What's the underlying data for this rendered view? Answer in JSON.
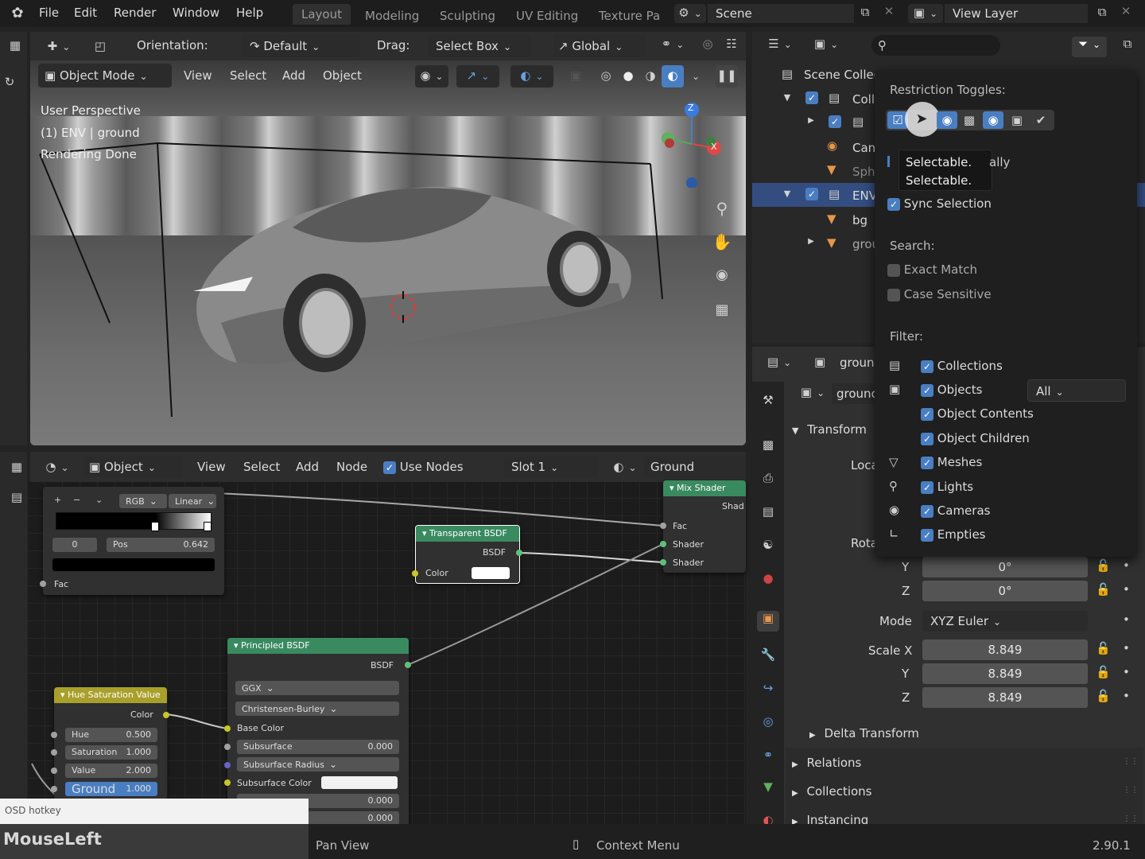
{
  "topbar": {
    "menus": [
      "File",
      "Edit",
      "Render",
      "Window",
      "Help"
    ],
    "workspaces": [
      "Layout",
      "Modeling",
      "Sculpting",
      "UV Editing",
      "Texture Pa"
    ],
    "scene": "Scene",
    "view_layer": "View Layer"
  },
  "viewport_header": {
    "orientation_label": "Orientation:",
    "orientation_value": "Default",
    "drag_label": "Drag:",
    "drag_value": "Select Box",
    "transform_space": "Global"
  },
  "viewport_toolbar": {
    "mode": "Object Mode",
    "menus": [
      "View",
      "Select",
      "Add",
      "Object"
    ]
  },
  "viewport_overlay": {
    "line1": "User Perspective",
    "line2": "(1) ENV | ground",
    "line3": "Rendering Done"
  },
  "gizmo": {
    "z": "Z",
    "x": "X"
  },
  "node_header": {
    "type": "Object",
    "menus": [
      "View",
      "Select",
      "Add",
      "Node"
    ],
    "use_nodes": "Use Nodes",
    "slot": "Slot 1",
    "material": "Ground"
  },
  "nodes": {
    "color_ramp": {
      "mode": "RGB",
      "interp": "Linear",
      "index": "0",
      "pos_label": "Pos",
      "pos_value": "0.642",
      "fac": "Fac",
      "stop_position": 0.642
    },
    "mix_shader": {
      "title": "Mix Shader",
      "out": "Shad",
      "in1": "Fac",
      "in2": "Shader",
      "in3": "Shader"
    },
    "transparent": {
      "title": "Transparent BSDF",
      "out": "BSDF",
      "color": "Color"
    },
    "principled": {
      "title": "Principled BSDF",
      "out": "BSDF",
      "distribution": "GGX",
      "sss": "Christensen-Burley",
      "base_color": "Base Color",
      "subsurface": "Subsurface",
      "subsurface_value": "0.000",
      "subsurface_radius": "Subsurface Radius",
      "subsurface_color": "Subsurface Color",
      "v1": "0.000",
      "v2": "0.000"
    },
    "hsv": {
      "title": "Hue Saturation Value",
      "out": "Color",
      "hue": "Hue",
      "hue_value": "0.500",
      "sat": "Saturation",
      "sat_value": "1.000",
      "val": "Value",
      "val_value": "2.000",
      "fac": "Ground",
      "fac_value": "1.000"
    }
  },
  "outliner": {
    "root": "Scene Collec",
    "rows": [
      "Coll",
      "",
      "Can",
      "Sph",
      "ENV",
      "bg",
      "grou"
    ]
  },
  "filter_popup": {
    "restriction_title": "Restriction Toggles:",
    "tooltip_line1": "Selectable.",
    "tooltip_line2": "Selectable.",
    "tooltip_tail": "ally",
    "sync_selection": "Sync Selection",
    "search_title": "Search:",
    "exact_match": "Exact Match",
    "case_sensitive": "Case Sensitive",
    "filter_title": "Filter:",
    "collections": "Collections",
    "objects": "Objects",
    "objects_type": "All",
    "object_contents": "Object Contents",
    "object_children": "Object Children",
    "meshes": "Meshes",
    "lights": "Lights",
    "cameras": "Cameras",
    "empties": "Empties"
  },
  "properties": {
    "object_name": "groun",
    "object_name2": "grounc",
    "transform": "Transform",
    "location_label": "Loca",
    "rotation_label": "Rota",
    "rot_y_label": "Y",
    "rot_y": "0°",
    "rot_z_label": "Z",
    "rot_z": "0°",
    "mode_label": "Mode",
    "mode_value": "XYZ Euler",
    "scale_x_label": "Scale X",
    "scale_x": "8.849",
    "scale_y_label": "Y",
    "scale_y": "8.849",
    "scale_z_label": "Z",
    "scale_z": "8.849",
    "delta_transform": "Delta Transform",
    "relations": "Relations",
    "collections": "Collections",
    "instancing": "Instancing"
  },
  "status": {
    "osd": "OSD hotkey",
    "mouse": "MouseLeft",
    "pan": "Pan View",
    "context": "Context Menu",
    "version": "2.90.1"
  },
  "colors": {
    "accent": "#4a7ec2",
    "shader_header": "#3a8a60",
    "converter_header": "#a8a02a",
    "selected_row": "#334d80"
  }
}
